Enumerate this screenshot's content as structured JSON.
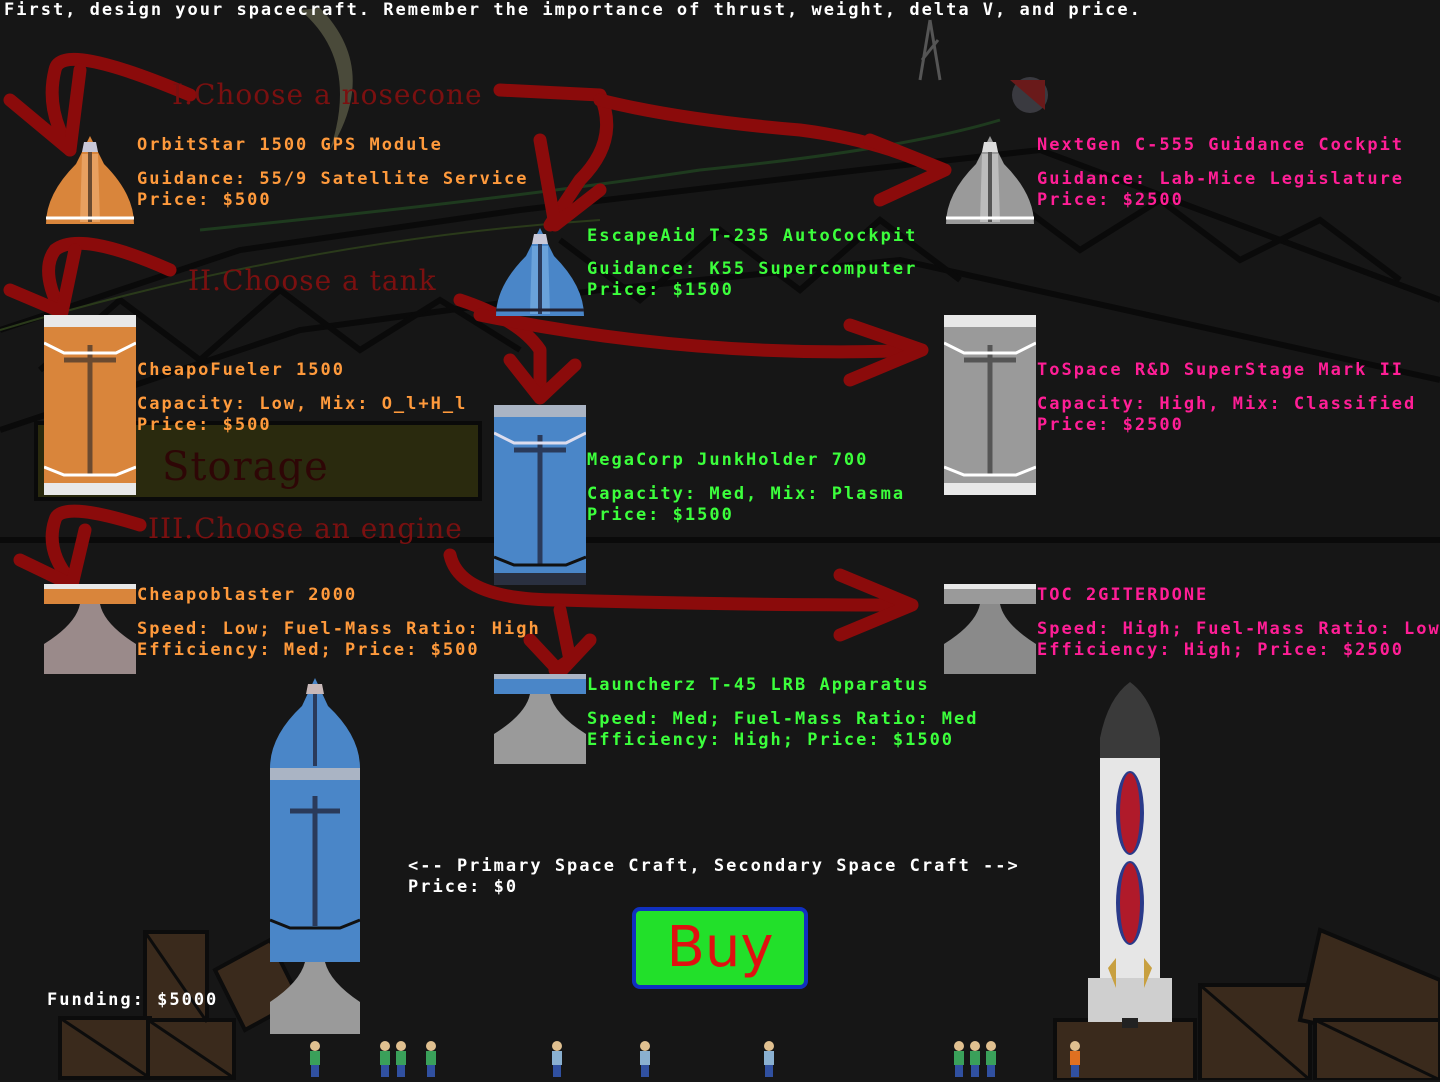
{
  "header": "First, design your spacecraft. Remember the importance of thrust, weight, delta V, and price.",
  "steps": {
    "nosecone": "I.Choose a nosecone",
    "tank": "II.Choose a tank",
    "engine": "III.Choose an engine"
  },
  "storage_label": "Storage",
  "nosecones": [
    {
      "name": "OrbitStar 1500 GPS Module",
      "line1": "Guidance: 55/9 Satellite Service",
      "line2": "Price: $500",
      "color": "#d9853b"
    },
    {
      "name": "EscapeAid T-235 AutoCockpit",
      "line1": "Guidance: K55 Supercomputer",
      "line2": "Price: $1500",
      "color": "#4a86c8"
    },
    {
      "name": "NextGen C-555 Guidance Cockpit",
      "line1": "Guidance: Lab-Mice Legislature",
      "line2": "Price: $2500",
      "color": "#9a9a9a"
    }
  ],
  "tanks": [
    {
      "name": "CheapoFueler 1500",
      "line1": "Capacity: Low, Mix:  O_l+H_l",
      "line2": "Price: $500",
      "color": "#d9853b"
    },
    {
      "name": "MegaCorp JunkHolder 700",
      "line1": "Capacity: Med, Mix: Plasma",
      "line2": "Price: $1500",
      "color": "#4a86c8"
    },
    {
      "name": "ToSpace R&D SuperStage Mark II",
      "line1": "Capacity: High, Mix: Classified",
      "line2": "Price: $2500",
      "color": "#9a9a9a"
    }
  ],
  "engines": [
    {
      "name": "Cheapoblaster 2000",
      "line1": "Speed: Low; Fuel-Mass Ratio: High",
      "line2": "Efficiency: Med; Price: $500",
      "color": "#d9853b"
    },
    {
      "name": "Launcherz T-45 LRB Apparatus",
      "line1": "Speed: Med; Fuel-Mass Ratio: Med",
      "line2": "Efficiency: High; Price: $1500",
      "color": "#4a86c8"
    },
    {
      "name": "TOC 2GITERDONE",
      "line1": "Speed: High; Fuel-Mass Ratio: Low",
      "line2": "Efficiency: High; Price: $2500",
      "color": "#9a9a9a"
    }
  ],
  "craft_switch": "<-- Primary Space Craft, Secondary Space Craft -->",
  "craft_price": "Price: $0",
  "buy_label": "Buy",
  "funding": "Funding: $5000",
  "colors": {
    "tier_low": "#ff9a3c",
    "tier_med": "#3cff3c",
    "tier_high": "#ff1e96",
    "arrow": "#8b0b0b"
  }
}
